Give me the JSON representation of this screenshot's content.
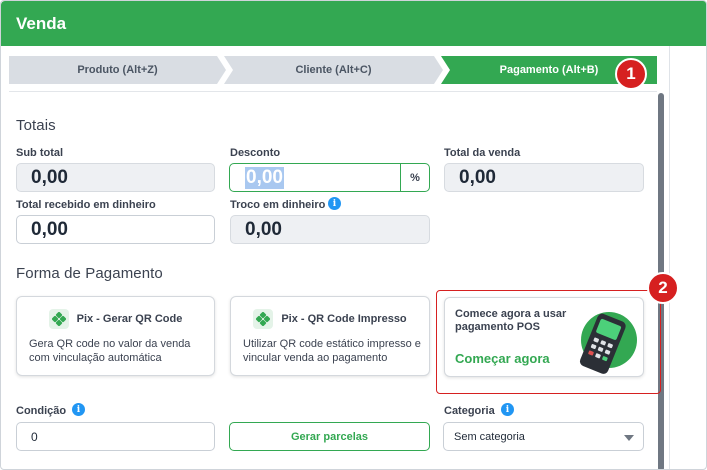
{
  "window": {
    "title": "Venda"
  },
  "steps": [
    {
      "label": "Produto (Alt+Z)",
      "active": false
    },
    {
      "label": "Cliente (Alt+C)",
      "active": false
    },
    {
      "label": "Pagamento (Alt+B)",
      "active": true
    }
  ],
  "annotations": {
    "badge1": "1",
    "badge2": "2"
  },
  "totais": {
    "heading": "Totais",
    "sub_total_label": "Sub total",
    "sub_total_value": "0,00",
    "desconto_label": "Desconto",
    "desconto_value": "0,00",
    "percent_symbol": "%",
    "total_venda_label": "Total da venda",
    "total_venda_value": "0,00",
    "total_recebido_label": "Total recebido em dinheiro",
    "total_recebido_value": "0,00",
    "troco_label": "Troco em dinheiro",
    "troco_value": "0,00"
  },
  "pagamento": {
    "heading": "Forma de Pagamento",
    "cards": [
      {
        "title": "Pix - Gerar QR Code",
        "description": "Gera QR code no valor da venda com vinculação automática"
      },
      {
        "title": "Pix - QR Code Impresso",
        "description": "Utilizar QR code estático impresso e vincular venda ao pagamento"
      }
    ],
    "pos_card": {
      "text": "Comece agora a usar pagamento POS",
      "link": "Começar agora"
    }
  },
  "condicao": {
    "label": "Condição",
    "value": "0"
  },
  "gerar_parcelas": {
    "label": "Gerar parcelas"
  },
  "categoria": {
    "label": "Categoria",
    "selected": "Sem categoria"
  },
  "icons": {
    "info": "i",
    "pix": "pix-icon",
    "pos": "pos-terminal-icon"
  },
  "colors": {
    "brand": "#33a852",
    "annotation": "#d62020",
    "info": "#2196f3"
  }
}
